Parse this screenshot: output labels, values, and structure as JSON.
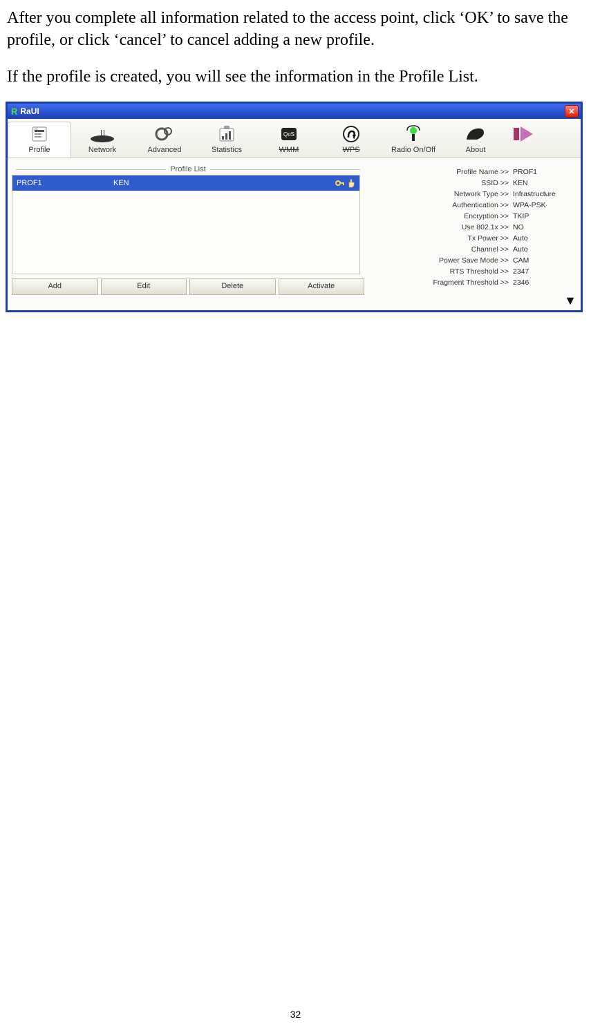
{
  "doc": {
    "p1": "After you complete all information related to the access point, click ‘OK’ to save the profile, or click ‘cancel’ to cancel adding a new profile.",
    "p2": "If the profile is created, you will see the information in the Profile List."
  },
  "window": {
    "title": "RaUI"
  },
  "tabs": {
    "profile": "Profile",
    "network": "Network",
    "advanced": "Advanced",
    "statistics": "Statistics",
    "wmm": "WMM",
    "wps": "WPS",
    "radio": "Radio On/Off",
    "about": "About"
  },
  "profile_list": {
    "title": "Profile List",
    "rows": [
      {
        "name": "PROF1",
        "ssid": "KEN"
      }
    ]
  },
  "buttons": {
    "add": "Add",
    "edit": "Edit",
    "delete": "Delete",
    "activate": "Activate"
  },
  "details": {
    "profile_name_lbl": "Profile Name >>",
    "profile_name_val": "PROF1",
    "ssid_lbl": "SSID >>",
    "ssid_val": "KEN",
    "network_type_lbl": "Network Type >>",
    "network_type_val": "Infrastructure",
    "auth_lbl": "Authentication >>",
    "auth_val": "WPA-PSK",
    "enc_lbl": "Encryption >>",
    "enc_val": "TKIP",
    "use8021x_lbl": "Use 802.1x >>",
    "use8021x_val": "NO",
    "txpower_lbl": "Tx Power >>",
    "txpower_val": "Auto",
    "channel_lbl": "Channel >>",
    "channel_val": "Auto",
    "psm_lbl": "Power Save Mode >>",
    "psm_val": "CAM",
    "rts_lbl": "RTS Threshold >>",
    "rts_val": "2347",
    "frag_lbl": "Fragment Threshold >>",
    "frag_val": "2346"
  },
  "page_number": "32"
}
